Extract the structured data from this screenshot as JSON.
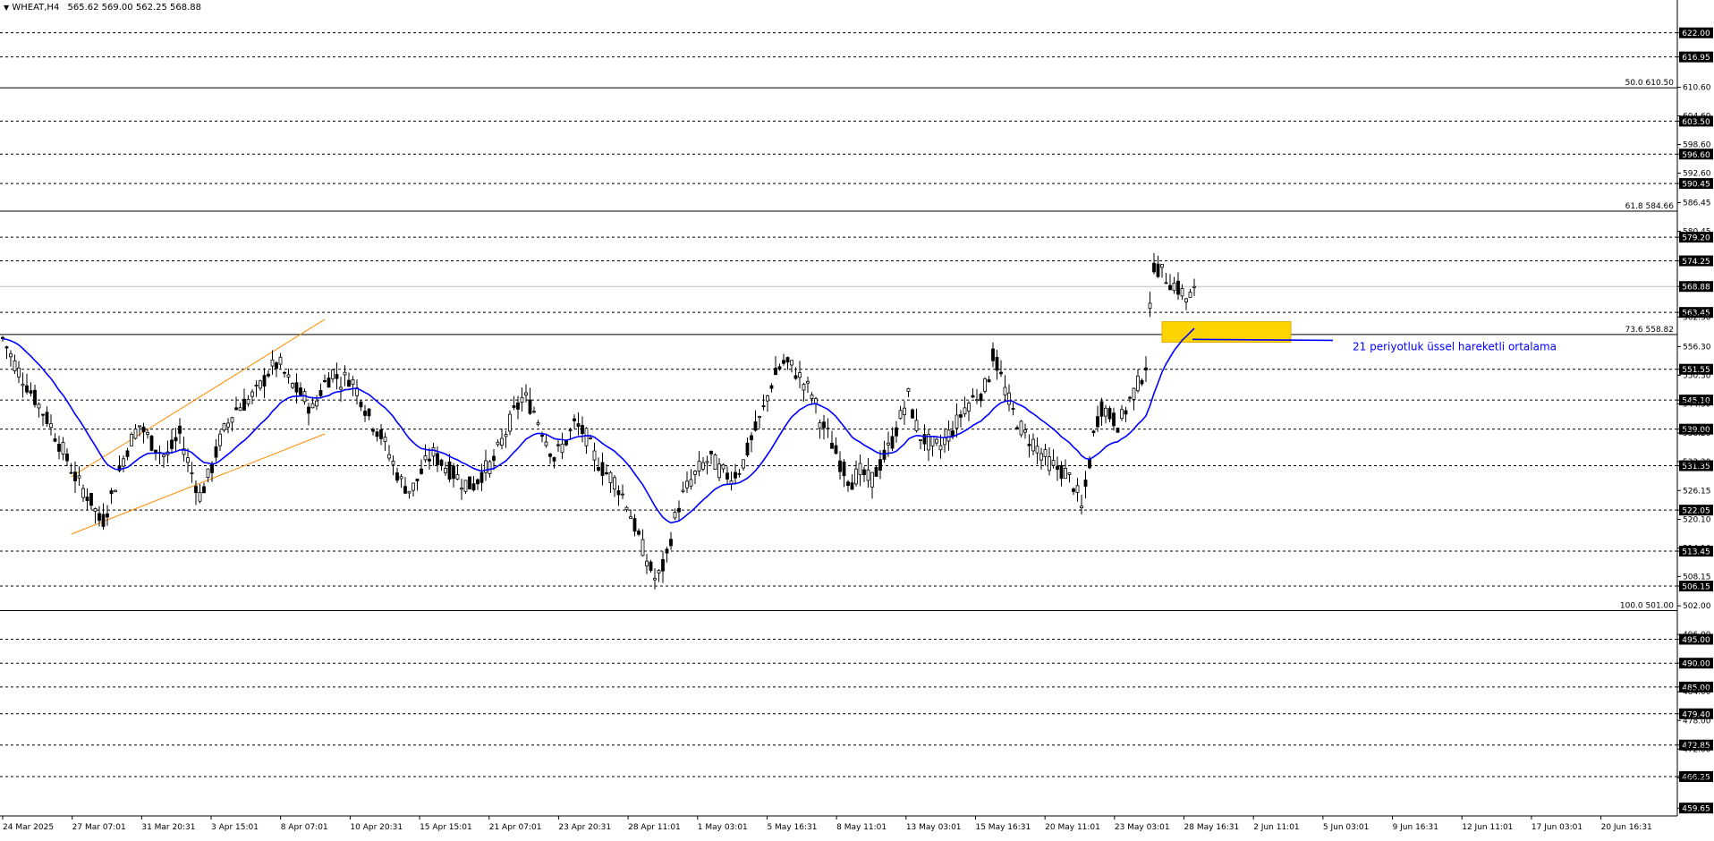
{
  "header": {
    "symbol": "WHEAT,H4",
    "ohlc": "565.62 569.00 562.25 568.88"
  },
  "chart_data": {
    "type": "candlestick",
    "symbol": "WHEAT",
    "timeframe": "H4",
    "ylim": [
      458.0,
      627.0
    ],
    "grid": false,
    "price_ticks": [
      "622.00",
      "616.95",
      "610.60",
      "604.60",
      "603.50",
      "598.60",
      "596.60",
      "592.60",
      "590.45",
      "586.45",
      "580.45",
      "579.20",
      "574.25",
      "568.88",
      "563.45",
      "562.50",
      "556.30",
      "551.55",
      "550.30",
      "545.10",
      "544.30",
      "539.00",
      "538.20",
      "531.35",
      "532.20",
      "526.15",
      "522.05",
      "520.10",
      "514.10",
      "513.45",
      "508.15",
      "506.15",
      "502.00",
      "496.00",
      "495.00",
      "490.00",
      "485.00",
      "484.00",
      "479.40",
      "478.00",
      "472.85",
      "472.00",
      "466.25",
      "466.00",
      "459.65"
    ],
    "price_tick_values": [
      622.0,
      616.95,
      610.6,
      604.6,
      603.5,
      598.6,
      596.6,
      592.6,
      590.45,
      586.45,
      580.45,
      579.2,
      574.25,
      568.88,
      563.45,
      562.5,
      556.3,
      551.55,
      550.3,
      545.1,
      544.3,
      539.0,
      538.2,
      531.35,
      532.2,
      526.15,
      522.05,
      520.1,
      514.1,
      513.45,
      508.15,
      506.15,
      502.0,
      496.0,
      495.0,
      490.0,
      485.0,
      484.0,
      479.4,
      478.0,
      472.85,
      472.0,
      466.25,
      466.0,
      459.65
    ],
    "highlighted_prices": [
      "622.00",
      "616.95",
      "603.50",
      "596.60",
      "590.45",
      "579.20",
      "574.25",
      "568.88",
      "563.45",
      "551.55",
      "545.10",
      "539.00",
      "531.35",
      "522.05",
      "513.45",
      "506.15",
      "495.00",
      "490.00",
      "485.00",
      "479.40",
      "472.85",
      "466.25",
      "459.65"
    ],
    "horizontal_levels": [
      622.0,
      616.95,
      603.5,
      596.6,
      590.45,
      579.2,
      574.25,
      563.45,
      551.55,
      545.1,
      539.0,
      531.35,
      522.05,
      513.45,
      506.15,
      495.0,
      490.0,
      485.0,
      479.4,
      472.85,
      466.25
    ],
    "current_price": 568.88,
    "fibonacci_levels": [
      {
        "label": "50.0 610.50",
        "price": 610.5
      },
      {
        "label": "61.8 584.66",
        "price": 584.66
      },
      {
        "label": "73.6 558.82",
        "price": 558.82
      },
      {
        "label": "100.0 501.00",
        "price": 501.0
      }
    ],
    "time_labels": [
      "24 Mar 2025",
      "27 Mar 07:01",
      "31 Mar 20:31",
      "3 Apr 15:01",
      "8 Apr 07:01",
      "10 Apr 20:31",
      "15 Apr 15:01",
      "21 Apr 07:01",
      "23 Apr 20:31",
      "28 Apr 11:01",
      "1 May 03:01",
      "5 May 16:31",
      "8 May 11:01",
      "13 May 03:01",
      "15 May 16:31",
      "20 May 11:01",
      "23 May 03:01",
      "28 May 16:31",
      "2 Jun 11:01",
      "5 Jun 03:01",
      "9 Jun 16:31",
      "12 Jun 11:01",
      "17 Jun 03:01",
      "20 Jun 16:31"
    ],
    "bar_count": 297,
    "price_path": [
      [
        0,
        558
      ],
      [
        8,
        552
      ],
      [
        18,
        546
      ],
      [
        28,
        540
      ],
      [
        36,
        534
      ],
      [
        44,
        528
      ],
      [
        52,
        524
      ],
      [
        58,
        519
      ],
      [
        64,
        525
      ],
      [
        72,
        534
      ],
      [
        80,
        540
      ],
      [
        88,
        536
      ],
      [
        96,
        533
      ],
      [
        104,
        538
      ],
      [
        110,
        531
      ],
      [
        116,
        525
      ],
      [
        122,
        530
      ],
      [
        128,
        537
      ],
      [
        136,
        543
      ],
      [
        144,
        545
      ],
      [
        150,
        547
      ],
      [
        156,
        551
      ],
      [
        162,
        553
      ],
      [
        168,
        549
      ],
      [
        176,
        546
      ],
      [
        182,
        543
      ],
      [
        188,
        548
      ],
      [
        194,
        551
      ],
      [
        198,
        549
      ],
      [
        204,
        550
      ],
      [
        210,
        546
      ],
      [
        216,
        541
      ],
      [
        222,
        538
      ],
      [
        228,
        533
      ],
      [
        234,
        528
      ],
      [
        240,
        526
      ],
      [
        246,
        530
      ],
      [
        252,
        534
      ],
      [
        258,
        532
      ],
      [
        264,
        530
      ],
      [
        270,
        528
      ],
      [
        276,
        527
      ],
      [
        282,
        530
      ],
      [
        288,
        532
      ],
      [
        294,
        537
      ],
      [
        300,
        542
      ],
      [
        306,
        546
      ],
      [
        312,
        543
      ],
      [
        318,
        538
      ],
      [
        324,
        533
      ],
      [
        330,
        536
      ],
      [
        336,
        540
      ],
      [
        342,
        538
      ],
      [
        348,
        533
      ],
      [
        354,
        530
      ],
      [
        360,
        528
      ],
      [
        366,
        524
      ],
      [
        372,
        518
      ],
      [
        378,
        512
      ],
      [
        384,
        507
      ],
      [
        390,
        512
      ],
      [
        394,
        519
      ],
      [
        398,
        524
      ],
      [
        404,
        528
      ],
      [
        410,
        531
      ],
      [
        416,
        533
      ],
      [
        422,
        530
      ],
      [
        428,
        529
      ],
      [
        434,
        531
      ],
      [
        440,
        537
      ],
      [
        446,
        542
      ],
      [
        452,
        549
      ],
      [
        458,
        553
      ],
      [
        464,
        552
      ],
      [
        470,
        549
      ],
      [
        476,
        546
      ],
      [
        480,
        541
      ],
      [
        486,
        537
      ],
      [
        492,
        532
      ],
      [
        498,
        528
      ],
      [
        504,
        530
      ],
      [
        510,
        528
      ],
      [
        516,
        532
      ],
      [
        522,
        536
      ],
      [
        528,
        542
      ],
      [
        532,
        546
      ],
      [
        538,
        538
      ],
      [
        544,
        536
      ],
      [
        550,
        535
      ],
      [
        556,
        538
      ],
      [
        560,
        540
      ],
      [
        566,
        544
      ],
      [
        572,
        546
      ],
      [
        578,
        548
      ],
      [
        582,
        555
      ],
      [
        588,
        548
      ],
      [
        594,
        542
      ],
      [
        600,
        538
      ],
      [
        606,
        536
      ],
      [
        612,
        533
      ],
      [
        618,
        531
      ],
      [
        624,
        530
      ],
      [
        630,
        527
      ],
      [
        634,
        522
      ],
      [
        638,
        531
      ],
      [
        642,
        540
      ],
      [
        646,
        544
      ],
      [
        650,
        542
      ],
      [
        656,
        540
      ],
      [
        662,
        545
      ],
      [
        668,
        549
      ],
      [
        672,
        553
      ],
      [
        676,
        574
      ],
      [
        680,
        572
      ],
      [
        686,
        570
      ],
      [
        692,
        568
      ],
      [
        696,
        566
      ],
      [
        700,
        568
      ]
    ],
    "annotations": [
      {
        "text": "21 periyotluk üssel hareketli ortalama"
      }
    ]
  },
  "colors": {
    "bull": "#ffffff",
    "bear": "#000000",
    "wick": "#000000",
    "ema": "#0000ff",
    "channel": "#ff8c00",
    "zone": "#ffd400",
    "zone_border": "#e6a800",
    "annotation": "#0000ff"
  }
}
